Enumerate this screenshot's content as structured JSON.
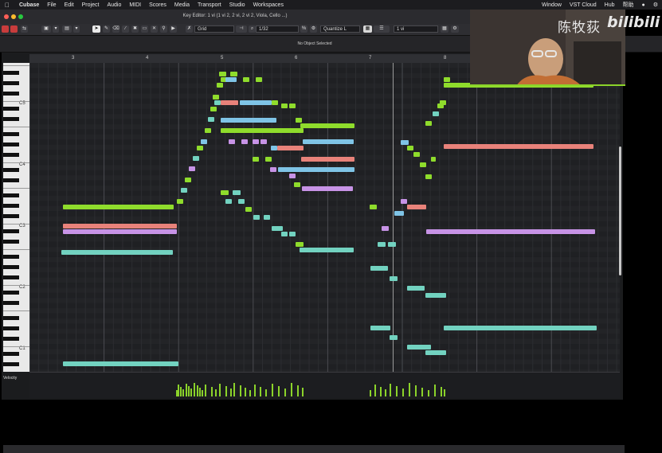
{
  "menubar": {
    "app_name": "Cubase",
    "items": [
      "File",
      "Edit",
      "Project",
      "Audio",
      "MIDI",
      "Scores",
      "Media",
      "Transport",
      "Studio",
      "Workspaces"
    ],
    "right_items": [
      "Window",
      "VST Cloud",
      "Hub",
      "帮助"
    ]
  },
  "window": {
    "title": "Key Editor: 1 vi (1 vi 2, 2 vi, 2 vi 2, Viola, Cello ...)"
  },
  "toolbar": {
    "grid_label": "Grid",
    "quantize_value": "1/32",
    "quantize_label": "Quantize L",
    "length_value": "1 vi"
  },
  "status": {
    "text": "No Object Selected"
  },
  "ruler": {
    "bars": [
      "3",
      "4",
      "5",
      "6",
      "7",
      "8"
    ]
  },
  "keyboard": {
    "octave_labels": [
      "C5",
      "C4",
      "C3",
      "C2",
      "C1"
    ]
  },
  "velocity": {
    "label": "Velocity"
  },
  "watermark": {
    "channel": "陈牧荻",
    "logo": "bilibili"
  },
  "colors": {
    "green": "#8fdc2c",
    "blue": "#7fc4e6",
    "teal": "#72d2c0",
    "salmon": "#e8827a",
    "purple": "#c793e6"
  }
}
